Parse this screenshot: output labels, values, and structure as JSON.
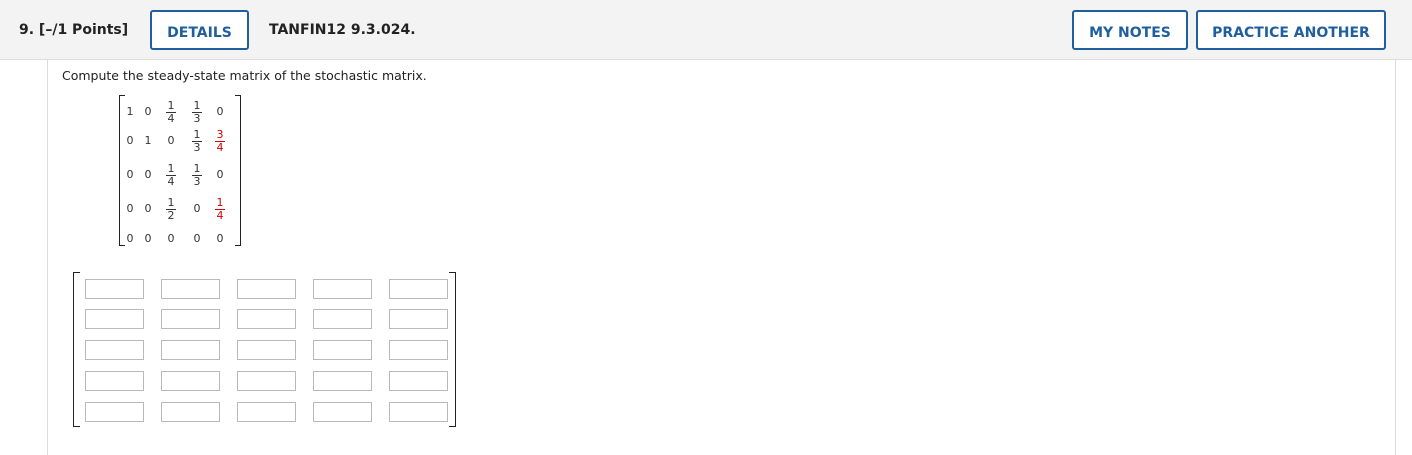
{
  "header": {
    "question_number": "9.  [–/1 Points]",
    "details_label": "DETAILS",
    "question_id": "TANFIN12 9.3.024.",
    "my_notes_label": "MY NOTES",
    "practice_label": "PRACTICE ANOTHER"
  },
  "prompt": "Compute the steady-state matrix of the stochastic matrix.",
  "matrix": {
    "rows": [
      [
        {
          "v": "1"
        },
        {
          "v": "0"
        },
        {
          "n": "1",
          "d": "4"
        },
        {
          "n": "1",
          "d": "3"
        },
        {
          "v": "0"
        }
      ],
      [
        {
          "v": "0"
        },
        {
          "v": "1"
        },
        {
          "v": "0"
        },
        {
          "n": "1",
          "d": "3"
        },
        {
          "n": "3",
          "d": "4",
          "red": true
        }
      ],
      [
        {
          "v": "0"
        },
        {
          "v": "0"
        },
        {
          "n": "1",
          "d": "4"
        },
        {
          "n": "1",
          "d": "3"
        },
        {
          "v": "0"
        }
      ],
      [
        {
          "v": "0"
        },
        {
          "v": "0"
        },
        {
          "n": "1",
          "d": "2"
        },
        {
          "v": "0"
        },
        {
          "n": "1",
          "d": "4",
          "red": true
        }
      ],
      [
        {
          "v": "0"
        },
        {
          "v": "0"
        },
        {
          "v": "0"
        },
        {
          "v": "0"
        },
        {
          "v": "0"
        }
      ]
    ]
  },
  "answer_grid": {
    "values": [
      [
        "",
        "",
        "",
        "",
        ""
      ],
      [
        "",
        "",
        "",
        "",
        ""
      ],
      [
        "",
        "",
        "",
        "",
        ""
      ],
      [
        "",
        "",
        "",
        "",
        ""
      ],
      [
        "",
        "",
        "",
        "",
        ""
      ]
    ]
  }
}
